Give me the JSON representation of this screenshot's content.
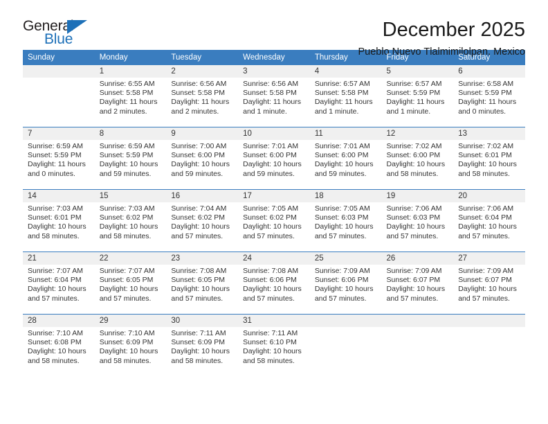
{
  "brand": {
    "name_top": "General",
    "name_bottom": "Blue",
    "accent_color": "#1d70b8"
  },
  "header": {
    "title": "December 2025",
    "subtitle": "Pueblo Nuevo Tlalmimilolpan, Mexico"
  },
  "calendar": {
    "header_bg": "#3a7dbf",
    "daynum_bg": "#f0f0f0",
    "weekdays": [
      "Sunday",
      "Monday",
      "Tuesday",
      "Wednesday",
      "Thursday",
      "Friday",
      "Saturday"
    ],
    "weeks": [
      [
        {
          "day": "",
          "lines": []
        },
        {
          "day": "1",
          "lines": [
            "Sunrise: 6:55 AM",
            "Sunset: 5:58 PM",
            "Daylight: 11 hours",
            "and 2 minutes."
          ]
        },
        {
          "day": "2",
          "lines": [
            "Sunrise: 6:56 AM",
            "Sunset: 5:58 PM",
            "Daylight: 11 hours",
            "and 2 minutes."
          ]
        },
        {
          "day": "3",
          "lines": [
            "Sunrise: 6:56 AM",
            "Sunset: 5:58 PM",
            "Daylight: 11 hours",
            "and 1 minute."
          ]
        },
        {
          "day": "4",
          "lines": [
            "Sunrise: 6:57 AM",
            "Sunset: 5:58 PM",
            "Daylight: 11 hours",
            "and 1 minute."
          ]
        },
        {
          "day": "5",
          "lines": [
            "Sunrise: 6:57 AM",
            "Sunset: 5:59 PM",
            "Daylight: 11 hours",
            "and 1 minute."
          ]
        },
        {
          "day": "6",
          "lines": [
            "Sunrise: 6:58 AM",
            "Sunset: 5:59 PM",
            "Daylight: 11 hours",
            "and 0 minutes."
          ]
        }
      ],
      [
        {
          "day": "7",
          "lines": [
            "Sunrise: 6:59 AM",
            "Sunset: 5:59 PM",
            "Daylight: 11 hours",
            "and 0 minutes."
          ]
        },
        {
          "day": "8",
          "lines": [
            "Sunrise: 6:59 AM",
            "Sunset: 5:59 PM",
            "Daylight: 10 hours",
            "and 59 minutes."
          ]
        },
        {
          "day": "9",
          "lines": [
            "Sunrise: 7:00 AM",
            "Sunset: 6:00 PM",
            "Daylight: 10 hours",
            "and 59 minutes."
          ]
        },
        {
          "day": "10",
          "lines": [
            "Sunrise: 7:01 AM",
            "Sunset: 6:00 PM",
            "Daylight: 10 hours",
            "and 59 minutes."
          ]
        },
        {
          "day": "11",
          "lines": [
            "Sunrise: 7:01 AM",
            "Sunset: 6:00 PM",
            "Daylight: 10 hours",
            "and 59 minutes."
          ]
        },
        {
          "day": "12",
          "lines": [
            "Sunrise: 7:02 AM",
            "Sunset: 6:00 PM",
            "Daylight: 10 hours",
            "and 58 minutes."
          ]
        },
        {
          "day": "13",
          "lines": [
            "Sunrise: 7:02 AM",
            "Sunset: 6:01 PM",
            "Daylight: 10 hours",
            "and 58 minutes."
          ]
        }
      ],
      [
        {
          "day": "14",
          "lines": [
            "Sunrise: 7:03 AM",
            "Sunset: 6:01 PM",
            "Daylight: 10 hours",
            "and 58 minutes."
          ]
        },
        {
          "day": "15",
          "lines": [
            "Sunrise: 7:03 AM",
            "Sunset: 6:02 PM",
            "Daylight: 10 hours",
            "and 58 minutes."
          ]
        },
        {
          "day": "16",
          "lines": [
            "Sunrise: 7:04 AM",
            "Sunset: 6:02 PM",
            "Daylight: 10 hours",
            "and 57 minutes."
          ]
        },
        {
          "day": "17",
          "lines": [
            "Sunrise: 7:05 AM",
            "Sunset: 6:02 PM",
            "Daylight: 10 hours",
            "and 57 minutes."
          ]
        },
        {
          "day": "18",
          "lines": [
            "Sunrise: 7:05 AM",
            "Sunset: 6:03 PM",
            "Daylight: 10 hours",
            "and 57 minutes."
          ]
        },
        {
          "day": "19",
          "lines": [
            "Sunrise: 7:06 AM",
            "Sunset: 6:03 PM",
            "Daylight: 10 hours",
            "and 57 minutes."
          ]
        },
        {
          "day": "20",
          "lines": [
            "Sunrise: 7:06 AM",
            "Sunset: 6:04 PM",
            "Daylight: 10 hours",
            "and 57 minutes."
          ]
        }
      ],
      [
        {
          "day": "21",
          "lines": [
            "Sunrise: 7:07 AM",
            "Sunset: 6:04 PM",
            "Daylight: 10 hours",
            "and 57 minutes."
          ]
        },
        {
          "day": "22",
          "lines": [
            "Sunrise: 7:07 AM",
            "Sunset: 6:05 PM",
            "Daylight: 10 hours",
            "and 57 minutes."
          ]
        },
        {
          "day": "23",
          "lines": [
            "Sunrise: 7:08 AM",
            "Sunset: 6:05 PM",
            "Daylight: 10 hours",
            "and 57 minutes."
          ]
        },
        {
          "day": "24",
          "lines": [
            "Sunrise: 7:08 AM",
            "Sunset: 6:06 PM",
            "Daylight: 10 hours",
            "and 57 minutes."
          ]
        },
        {
          "day": "25",
          "lines": [
            "Sunrise: 7:09 AM",
            "Sunset: 6:06 PM",
            "Daylight: 10 hours",
            "and 57 minutes."
          ]
        },
        {
          "day": "26",
          "lines": [
            "Sunrise: 7:09 AM",
            "Sunset: 6:07 PM",
            "Daylight: 10 hours",
            "and 57 minutes."
          ]
        },
        {
          "day": "27",
          "lines": [
            "Sunrise: 7:09 AM",
            "Sunset: 6:07 PM",
            "Daylight: 10 hours",
            "and 57 minutes."
          ]
        }
      ],
      [
        {
          "day": "28",
          "lines": [
            "Sunrise: 7:10 AM",
            "Sunset: 6:08 PM",
            "Daylight: 10 hours",
            "and 58 minutes."
          ]
        },
        {
          "day": "29",
          "lines": [
            "Sunrise: 7:10 AM",
            "Sunset: 6:09 PM",
            "Daylight: 10 hours",
            "and 58 minutes."
          ]
        },
        {
          "day": "30",
          "lines": [
            "Sunrise: 7:11 AM",
            "Sunset: 6:09 PM",
            "Daylight: 10 hours",
            "and 58 minutes."
          ]
        },
        {
          "day": "31",
          "lines": [
            "Sunrise: 7:11 AM",
            "Sunset: 6:10 PM",
            "Daylight: 10 hours",
            "and 58 minutes."
          ]
        },
        {
          "day": "",
          "lines": []
        },
        {
          "day": "",
          "lines": []
        },
        {
          "day": "",
          "lines": []
        }
      ]
    ]
  }
}
